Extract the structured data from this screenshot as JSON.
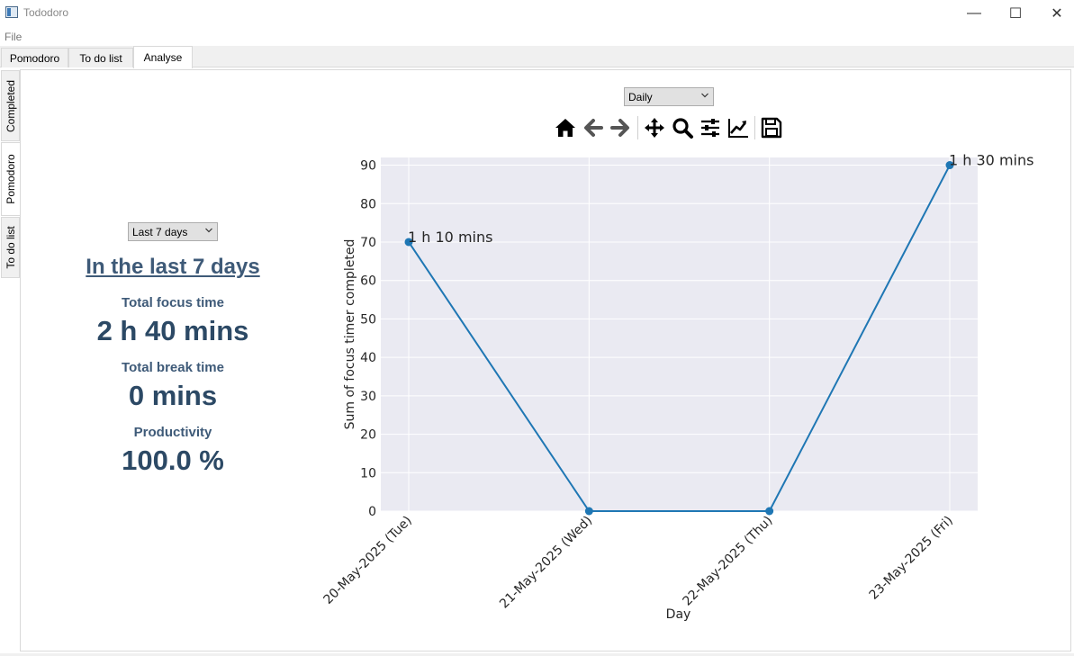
{
  "window": {
    "title": "Tododoro",
    "controls": {
      "minimize": "—",
      "maximize": "☐",
      "close": "✕"
    }
  },
  "menu": {
    "file": "File"
  },
  "tabs": [
    {
      "label": "Pomodoro",
      "active": false
    },
    {
      "label": "To do list",
      "active": false
    },
    {
      "label": "Analyse",
      "active": true
    }
  ],
  "side_tabs": [
    {
      "label": "Completed",
      "active": false
    },
    {
      "label": "Pomodoro",
      "active": true
    },
    {
      "label": "To do list",
      "active": false
    }
  ],
  "stats": {
    "range_select": "Last 7 days",
    "period_title": "In the last 7 days",
    "focus_label": "Total focus time",
    "focus_value": "2 h 40 mins",
    "break_label": "Total break time",
    "break_value": "0 mins",
    "productivity_label": "Productivity",
    "productivity_value": "100.0 %"
  },
  "granularity_select": "Daily",
  "toolbar_icons": [
    "home-icon",
    "back-arrow-icon",
    "forward-arrow-icon",
    "pan-icon",
    "zoom-icon",
    "configure-subplots-icon",
    "edit-axis-icon",
    "save-icon"
  ],
  "colors": {
    "series": "#1f77b4",
    "plot_bg": "#eaeaf2",
    "heading": "#2c4965"
  },
  "chart_data": {
    "type": "line",
    "categories": [
      "20-May-2025 (Tue)",
      "21-May-2025 (Wed)",
      "22-May-2025 (Thu)",
      "23-May-2025 (Fri)"
    ],
    "values": [
      70,
      0,
      0,
      90
    ],
    "annotations": [
      "1 h 10 mins",
      "",
      "",
      "1 h 30 mins"
    ],
    "xlabel": "Day",
    "ylabel": "Sum of focus timer completed",
    "ylim": [
      0,
      92
    ],
    "yticks": [
      0,
      10,
      20,
      30,
      40,
      50,
      60,
      70,
      80,
      90
    ],
    "grid": true
  }
}
